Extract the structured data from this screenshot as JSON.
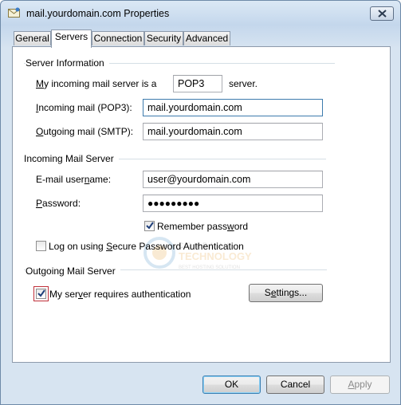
{
  "window": {
    "title": "mail.yourdomain.com Properties"
  },
  "tabs": [
    {
      "label": "General"
    },
    {
      "label": "Servers"
    },
    {
      "label": "Connection"
    },
    {
      "label": "Security"
    },
    {
      "label": "Advanced"
    }
  ],
  "active_tab": "Servers",
  "server_information": {
    "title": "Server Information",
    "incoming_type_label_pre": "M",
    "incoming_type_label_rest": "y incoming mail server is a",
    "incoming_type_value": "POP3",
    "incoming_type_suffix": "server.",
    "incoming_mail_label_pre": "I",
    "incoming_mail_label_rest": "ncoming mail (POP3):",
    "incoming_mail_value": "mail.yourdomain.com",
    "outgoing_mail_label_pre": "O",
    "outgoing_mail_label_rest": "utgoing mail (SMTP):",
    "outgoing_mail_value": "mail.yourdomain.com"
  },
  "incoming_mail_server": {
    "title": "Incoming Mail Server",
    "username_label_a": "E-mail user",
    "username_label_u": "n",
    "username_label_b": "ame:",
    "username_value": "user@yourdomain.com",
    "password_label_u": "P",
    "password_label_rest": "assword:",
    "password_value": "●●●●●●●●●",
    "remember_label_a": "Remember pass",
    "remember_label_u": "w",
    "remember_label_b": "ord",
    "remember_checked": true,
    "spa_label_a": "Log on using ",
    "spa_label_u": "S",
    "spa_label_b": "ecure Password Authentication",
    "spa_checked": false
  },
  "outgoing_mail_server": {
    "title": "Outgoing Mail Server",
    "auth_label_a": "My ser",
    "auth_label_u": "v",
    "auth_label_b": "er requires authentication",
    "auth_checked": true,
    "settings_label_a": "S",
    "settings_label_u": "e",
    "settings_label_b": "ttings..."
  },
  "buttons": {
    "ok": "OK",
    "cancel": "Cancel",
    "apply_u": "A",
    "apply_rest": "pply"
  },
  "watermark": {
    "line1": "COMPANY",
    "line2": "TECHNOLOGY",
    "line3": "BEST HOSTING SOLUTION"
  },
  "colors": {
    "focus_ring": "#c0303a",
    "default_button_border": "#3c7fb1"
  }
}
